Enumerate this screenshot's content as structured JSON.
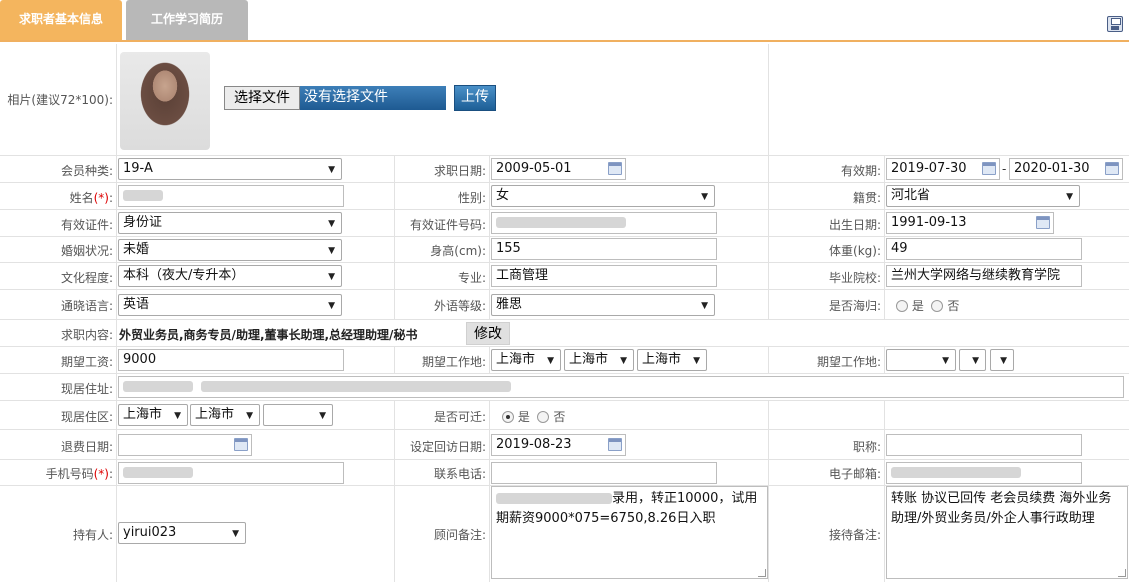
{
  "tabs": {
    "basic": "求职者基本信息",
    "resume": "工作学习简历"
  },
  "photo": {
    "label": "相片(建议72*100):",
    "choose_file": "选择文件",
    "no_file": "没有选择文件",
    "upload": "上传"
  },
  "member_type": {
    "label": "会员种类:",
    "value": "19-A"
  },
  "job_date": {
    "label": "求职日期:",
    "value": "2009-05-01"
  },
  "validity": {
    "label": "有效期:",
    "from": "2019-07-30",
    "sep": "-",
    "to": "2020-01-30"
  },
  "name": {
    "label": "姓名",
    "req": "(*)",
    "colon": ":"
  },
  "gender": {
    "label": "性别:",
    "value": "女"
  },
  "native_place": {
    "label": "籍贯:",
    "value": "河北省"
  },
  "id_doc": {
    "label": "有效证件:",
    "value": "身份证"
  },
  "id_no": {
    "label": "有效证件号码:"
  },
  "birth": {
    "label": "出生日期:",
    "value": "1991-09-13"
  },
  "marital": {
    "label": "婚姻状况:",
    "value": "未婚"
  },
  "height": {
    "label": "身高(cm):",
    "value": "155"
  },
  "weight": {
    "label": "体重(kg):",
    "value": "49"
  },
  "education": {
    "label": "文化程度:",
    "value": "本科（夜大/专升本）"
  },
  "major": {
    "label": "专业:",
    "value": "工商管理"
  },
  "school": {
    "label": "毕业院校:",
    "value": "兰州大学网络与继续教育学院"
  },
  "language": {
    "label": "通晓语言:",
    "value": "英语"
  },
  "lang_level": {
    "label": "外语等级:",
    "value": "雅思"
  },
  "returnee": {
    "label": "是否海归:",
    "yes": "是",
    "no": "否"
  },
  "job_content": {
    "label": "求职内容:",
    "value": "外贸业务员,商务专员/助理,董事长助理,总经理助理/秘书",
    "edit": "修改"
  },
  "salary": {
    "label": "期望工资:",
    "value": "9000"
  },
  "work_place1": {
    "label": "期望工作地:",
    "a": "上海市",
    "b": "上海市",
    "c": "上海市"
  },
  "work_place2": {
    "label": "期望工作地:"
  },
  "address": {
    "label": "现居住址:"
  },
  "district": {
    "label": "现居住区:",
    "a": "上海市",
    "b": "上海市"
  },
  "relocate": {
    "label": "是否可迁:",
    "yes": "是",
    "no": "否"
  },
  "refund_date": {
    "label": "退费日期:"
  },
  "visit_date": {
    "label": "设定回访日期:",
    "value": "2019-08-23"
  },
  "title": {
    "label": "职称:"
  },
  "mobile": {
    "label": "手机号码",
    "req": "(*)",
    "colon": ":"
  },
  "phone": {
    "label": "联系电话:"
  },
  "email": {
    "label": "电子邮箱:"
  },
  "holder": {
    "label": "持有人:",
    "value": "yirui023"
  },
  "advisor_note": {
    "label": "顾问备注:",
    "value": "录用，转正10000，试用期薪资9000*075=6750,8.26日入职"
  },
  "reception_note": {
    "label": "接待备注:",
    "value": "转账 协议已回传 老会员续费 海外业务助理/外贸业务员/外企人事行政助理"
  }
}
